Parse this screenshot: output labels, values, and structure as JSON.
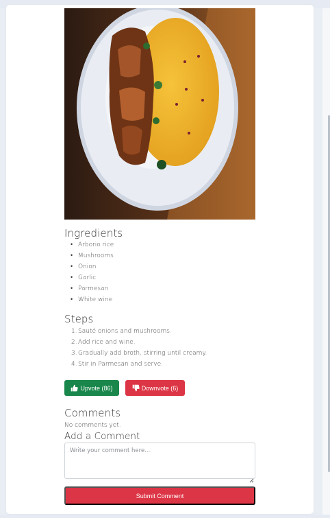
{
  "recipe": {
    "image_alt": "Mushroom risotto",
    "ingredients_heading": "Ingredients",
    "ingredients": [
      "Arborio rice",
      "Mushrooms",
      "Onion",
      "Garlic",
      "Parmesan",
      "White wine"
    ],
    "steps_heading": "Steps",
    "steps": [
      {
        "num": "1.",
        "text": "Sauté onions and mushrooms."
      },
      {
        "num": "2.",
        "text": "Add rice and wine."
      },
      {
        "num": "3.",
        "text": "Gradually add broth, stirring until creamy."
      },
      {
        "num": "4.",
        "text": "Stir in Parmesan and serve."
      }
    ]
  },
  "votes": {
    "upvote_label": "Upvote (86)",
    "downvote_label": "Downvote (6)",
    "upvote_icon": "thumbs-up-icon",
    "downvote_icon": "thumbs-down-icon",
    "upvote_color": "#19874b",
    "downvote_color": "#dc3545"
  },
  "comments": {
    "heading": "Comments",
    "empty_text": "No comments yet.",
    "add_heading": "Add a Comment",
    "placeholder": "Write your comment here...",
    "value": "",
    "submit_label": "Submit Comment"
  }
}
